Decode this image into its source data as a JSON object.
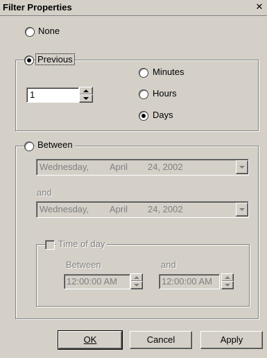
{
  "window": {
    "title": "Filter Properties",
    "close_glyph": "✕"
  },
  "options": {
    "none_label": "None",
    "previous_label": "Previous",
    "between_label": "Between",
    "selected": "previous"
  },
  "previous": {
    "amount_value": "1",
    "units": [
      {
        "label": "Minutes",
        "selected": false
      },
      {
        "label": "Hours",
        "selected": false
      },
      {
        "label": "Days",
        "selected": true
      }
    ]
  },
  "between": {
    "start_date": {
      "weekday": "Wednesday,",
      "month": "April",
      "day_year": "24, 2002"
    },
    "and_label": "and",
    "end_date": {
      "weekday": "Wednesday,",
      "month": "April",
      "day_year": "24, 2002"
    },
    "time_of_day": {
      "label": "Time of day",
      "checked": false,
      "between_label": "Between",
      "and_label": "and",
      "start_time": "12:00:00 AM",
      "end_time": "12:00:00 AM"
    }
  },
  "buttons": {
    "ok": "OK",
    "cancel": "Cancel",
    "apply": "Apply"
  },
  "colors": {
    "face": "#d4d0c8",
    "shadow": "#808080",
    "disabled_text": "#808080"
  }
}
